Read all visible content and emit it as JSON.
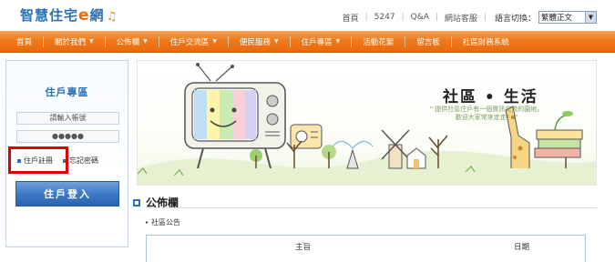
{
  "header": {
    "logo_main": "智慧住宅",
    "logo_e": "e",
    "logo_tail": "網",
    "logo_note": "♫",
    "links": [
      "首頁",
      "5247",
      "Q&A",
      "網站客服"
    ],
    "lang_label": "語言切換：",
    "lang_selected": "繁體正文"
  },
  "nav": {
    "items": [
      {
        "label": "首頁",
        "dropdown": false
      },
      {
        "label": "關於我們",
        "dropdown": true
      },
      {
        "label": "公佈欄",
        "dropdown": true
      },
      {
        "label": "住戶交流區",
        "dropdown": true
      },
      {
        "label": "便民服務",
        "dropdown": true
      },
      {
        "label": "住戶專區",
        "dropdown": true
      },
      {
        "label": "活動花絮",
        "dropdown": false
      },
      {
        "label": "留言板",
        "dropdown": false
      },
      {
        "label": "社區財務系統",
        "dropdown": false
      }
    ]
  },
  "sidebar": {
    "title": "住戶專區",
    "account_placeholder": "請輸入帳號",
    "password_value": "●●●●●",
    "register_label": "住戶註冊",
    "forgot_label": "忘記密碼",
    "login_label": "住戶登入"
  },
  "banner": {
    "title": "社區 • 生活",
    "subtitle_line1": "\" 提供社區住戶有一個資訊交流的園地，",
    "subtitle_line2": "歡迎大家常來走走！ \""
  },
  "bulletin": {
    "title": "公佈欄",
    "sub_item": "社區公告",
    "col_subject": "主旨",
    "col_date": "日期"
  },
  "colors": {
    "brand_blue": "#2a72b8",
    "nav_orange": "#ee7a1c",
    "highlight_red": "#e00000"
  }
}
